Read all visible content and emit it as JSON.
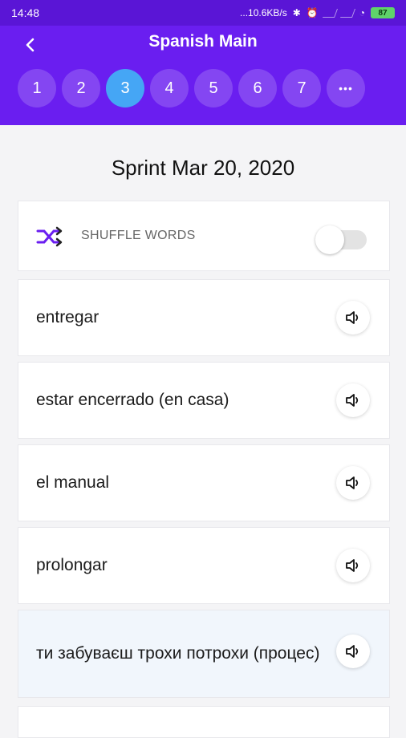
{
  "status_bar": {
    "time": "14:48",
    "network_speed": "...10.6KB/s",
    "battery": "87"
  },
  "header": {
    "title": "Spanish Main",
    "tabs": [
      "1",
      "2",
      "3",
      "4",
      "5",
      "6",
      "7",
      "•••"
    ],
    "active_tab": "3"
  },
  "main": {
    "sprint_title": "Sprint Mar 20, 2020",
    "shuffle": {
      "label": "SHUFFLE WORDS",
      "enabled": false
    },
    "words": [
      "entregar",
      "estar encerrado (en casa)",
      "el manual",
      "prolongar",
      "ти забуваєш трохи потрохи (процес)"
    ]
  },
  "colors": {
    "header": "#6a1ef0",
    "status_bar": "#5a15d6",
    "active_tab": "#45a6f5",
    "shuffle_icon": "#6a1ef0"
  }
}
